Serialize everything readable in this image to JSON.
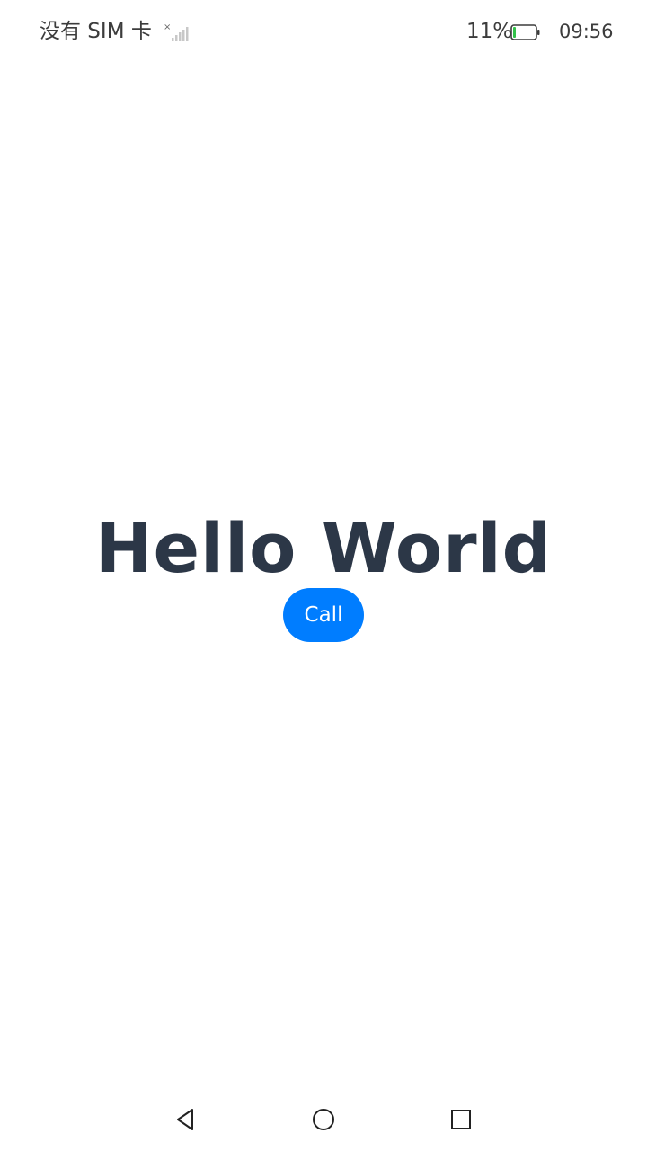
{
  "status_bar": {
    "carrier": "没有 SIM 卡",
    "battery_percent": "11%",
    "battery_level": 0.11,
    "time": "09:56"
  },
  "main": {
    "title": "Hello World",
    "call_button_label": "Call"
  },
  "colors": {
    "accent": "#007dff",
    "title": "#2c3747",
    "battery_fill": "#33c24a"
  },
  "nav_bar": {
    "back": "back-triangle-icon",
    "home": "home-circle-icon",
    "recent": "recent-square-icon"
  }
}
